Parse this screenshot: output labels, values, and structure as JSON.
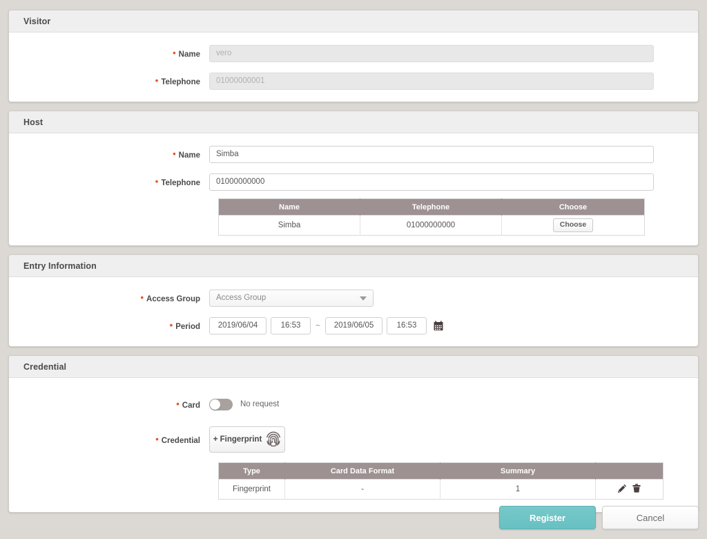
{
  "sections": {
    "visitor": {
      "title": "Visitor",
      "name_label": "Name",
      "name_value": "vero",
      "telephone_label": "Telephone",
      "telephone_value": "01000000001"
    },
    "host": {
      "title": "Host",
      "name_label": "Name",
      "name_value": "Simba",
      "telephone_label": "Telephone",
      "telephone_value": "01000000000",
      "table": {
        "columns": [
          "Name",
          "Telephone",
          "Choose"
        ],
        "rows": [
          {
            "name": "Simba",
            "telephone": "01000000000",
            "choose_label": "Choose"
          }
        ]
      }
    },
    "entry_information": {
      "title": "Entry Information",
      "access_group_label": "Access Group",
      "access_group_value": "Access Group",
      "period_label": "Period",
      "start_date": "2019/06/04",
      "start_time": "16:53",
      "separator": "~",
      "end_date": "2019/06/05",
      "end_time": "16:53",
      "calendar_icon": "calendar-icon"
    },
    "credential": {
      "title": "Credential",
      "card_label": "Card",
      "card_toggle_state": "off",
      "card_toggle_text": "No request",
      "credential_label": "Credential",
      "fingerprint_button_label": "+ Fingerprint",
      "fingerprint_icon": "fingerprint-icon",
      "table": {
        "columns": [
          "Type",
          "Card Data Format",
          "Summary",
          ""
        ],
        "rows": [
          {
            "type": "Fingerprint",
            "card_data_format": "-",
            "summary": "1",
            "edit_icon": "pencil-icon",
            "delete_icon": "trash-icon"
          }
        ]
      }
    }
  },
  "footer": {
    "register_label": "Register",
    "cancel_label": "Cancel"
  },
  "colors": {
    "background": "#dcd8d4",
    "panel_header": "#efefef",
    "table_header": "#9d9192",
    "required_marker": "#e8532b",
    "primary_button": "#6ec4c6"
  }
}
